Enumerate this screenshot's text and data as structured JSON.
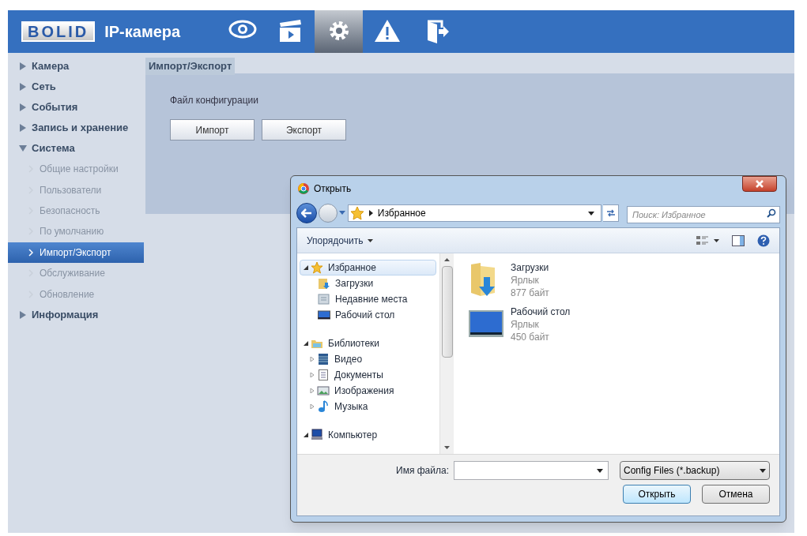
{
  "header": {
    "logo": "BOLID",
    "title": "IP-камера",
    "nav": [
      {
        "kind": "eye",
        "selected": false
      },
      {
        "kind": "film",
        "selected": false
      },
      {
        "kind": "gear",
        "selected": true
      },
      {
        "kind": "warning",
        "selected": false
      },
      {
        "kind": "exit",
        "selected": false
      }
    ]
  },
  "sidebar": {
    "items": [
      {
        "label": "Камера",
        "expanded": false
      },
      {
        "label": "Сеть",
        "expanded": false
      },
      {
        "label": "События",
        "expanded": false
      },
      {
        "label": "Запись и хранение",
        "expanded": false
      },
      {
        "label": "Система",
        "expanded": true,
        "children": [
          {
            "label": "Общие настройки",
            "selected": false
          },
          {
            "label": "Пользователи",
            "selected": false
          },
          {
            "label": "Безопасность",
            "selected": false
          },
          {
            "label": "По умолчанию",
            "selected": false
          },
          {
            "label": "Импорт/Экспорт",
            "selected": true
          },
          {
            "label": "Обслуживание",
            "selected": false
          },
          {
            "label": "Обновление",
            "selected": false
          }
        ]
      },
      {
        "label": "Информация",
        "expanded": false
      }
    ]
  },
  "content": {
    "tab": "Импорт/Экспорт",
    "label": "Файл конфигурации",
    "buttons": [
      "Импорт",
      "Экспорт"
    ]
  },
  "dialog": {
    "title": "Открыть",
    "address": "Избранное",
    "search": {
      "placeholder": "Поиск: Избранное"
    },
    "organize": "Упорядочить",
    "tree": [
      {
        "label": "Избранное",
        "kind": "star",
        "expanded": true,
        "selected": true,
        "children": [
          {
            "label": "Загрузки",
            "kind": "downloads",
            "selected": false
          },
          {
            "label": "Недавние места",
            "kind": "recent",
            "selected": false
          },
          {
            "label": "Рабочий стол",
            "kind": "desktop",
            "selected": false
          }
        ]
      },
      {
        "label": "Библиотеки",
        "kind": "library",
        "expanded": true,
        "selected": false,
        "children": [
          {
            "label": "Видео",
            "kind": "video",
            "expanded": false,
            "selected": false
          },
          {
            "label": "Документы",
            "kind": "docs",
            "expanded": false,
            "selected": false
          },
          {
            "label": "Изображения",
            "kind": "images",
            "expanded": false,
            "selected": false
          },
          {
            "label": "Музыка",
            "kind": "music",
            "expanded": false,
            "selected": false
          }
        ]
      },
      {
        "label": "Компьютер",
        "kind": "computer",
        "expanded": true,
        "selected": false
      }
    ],
    "files": [
      {
        "name": "Загрузки",
        "type": "Ярлык",
        "size": "877 байт",
        "kind": "downloads"
      },
      {
        "name": "Рабочий стол",
        "type": "Ярлык",
        "size": "450 байт",
        "kind": "desktop"
      }
    ],
    "filename_label": "Имя файла:",
    "filetype": "Config Files (*.backup)",
    "buttons": [
      "Открыть",
      "Отмена"
    ]
  }
}
